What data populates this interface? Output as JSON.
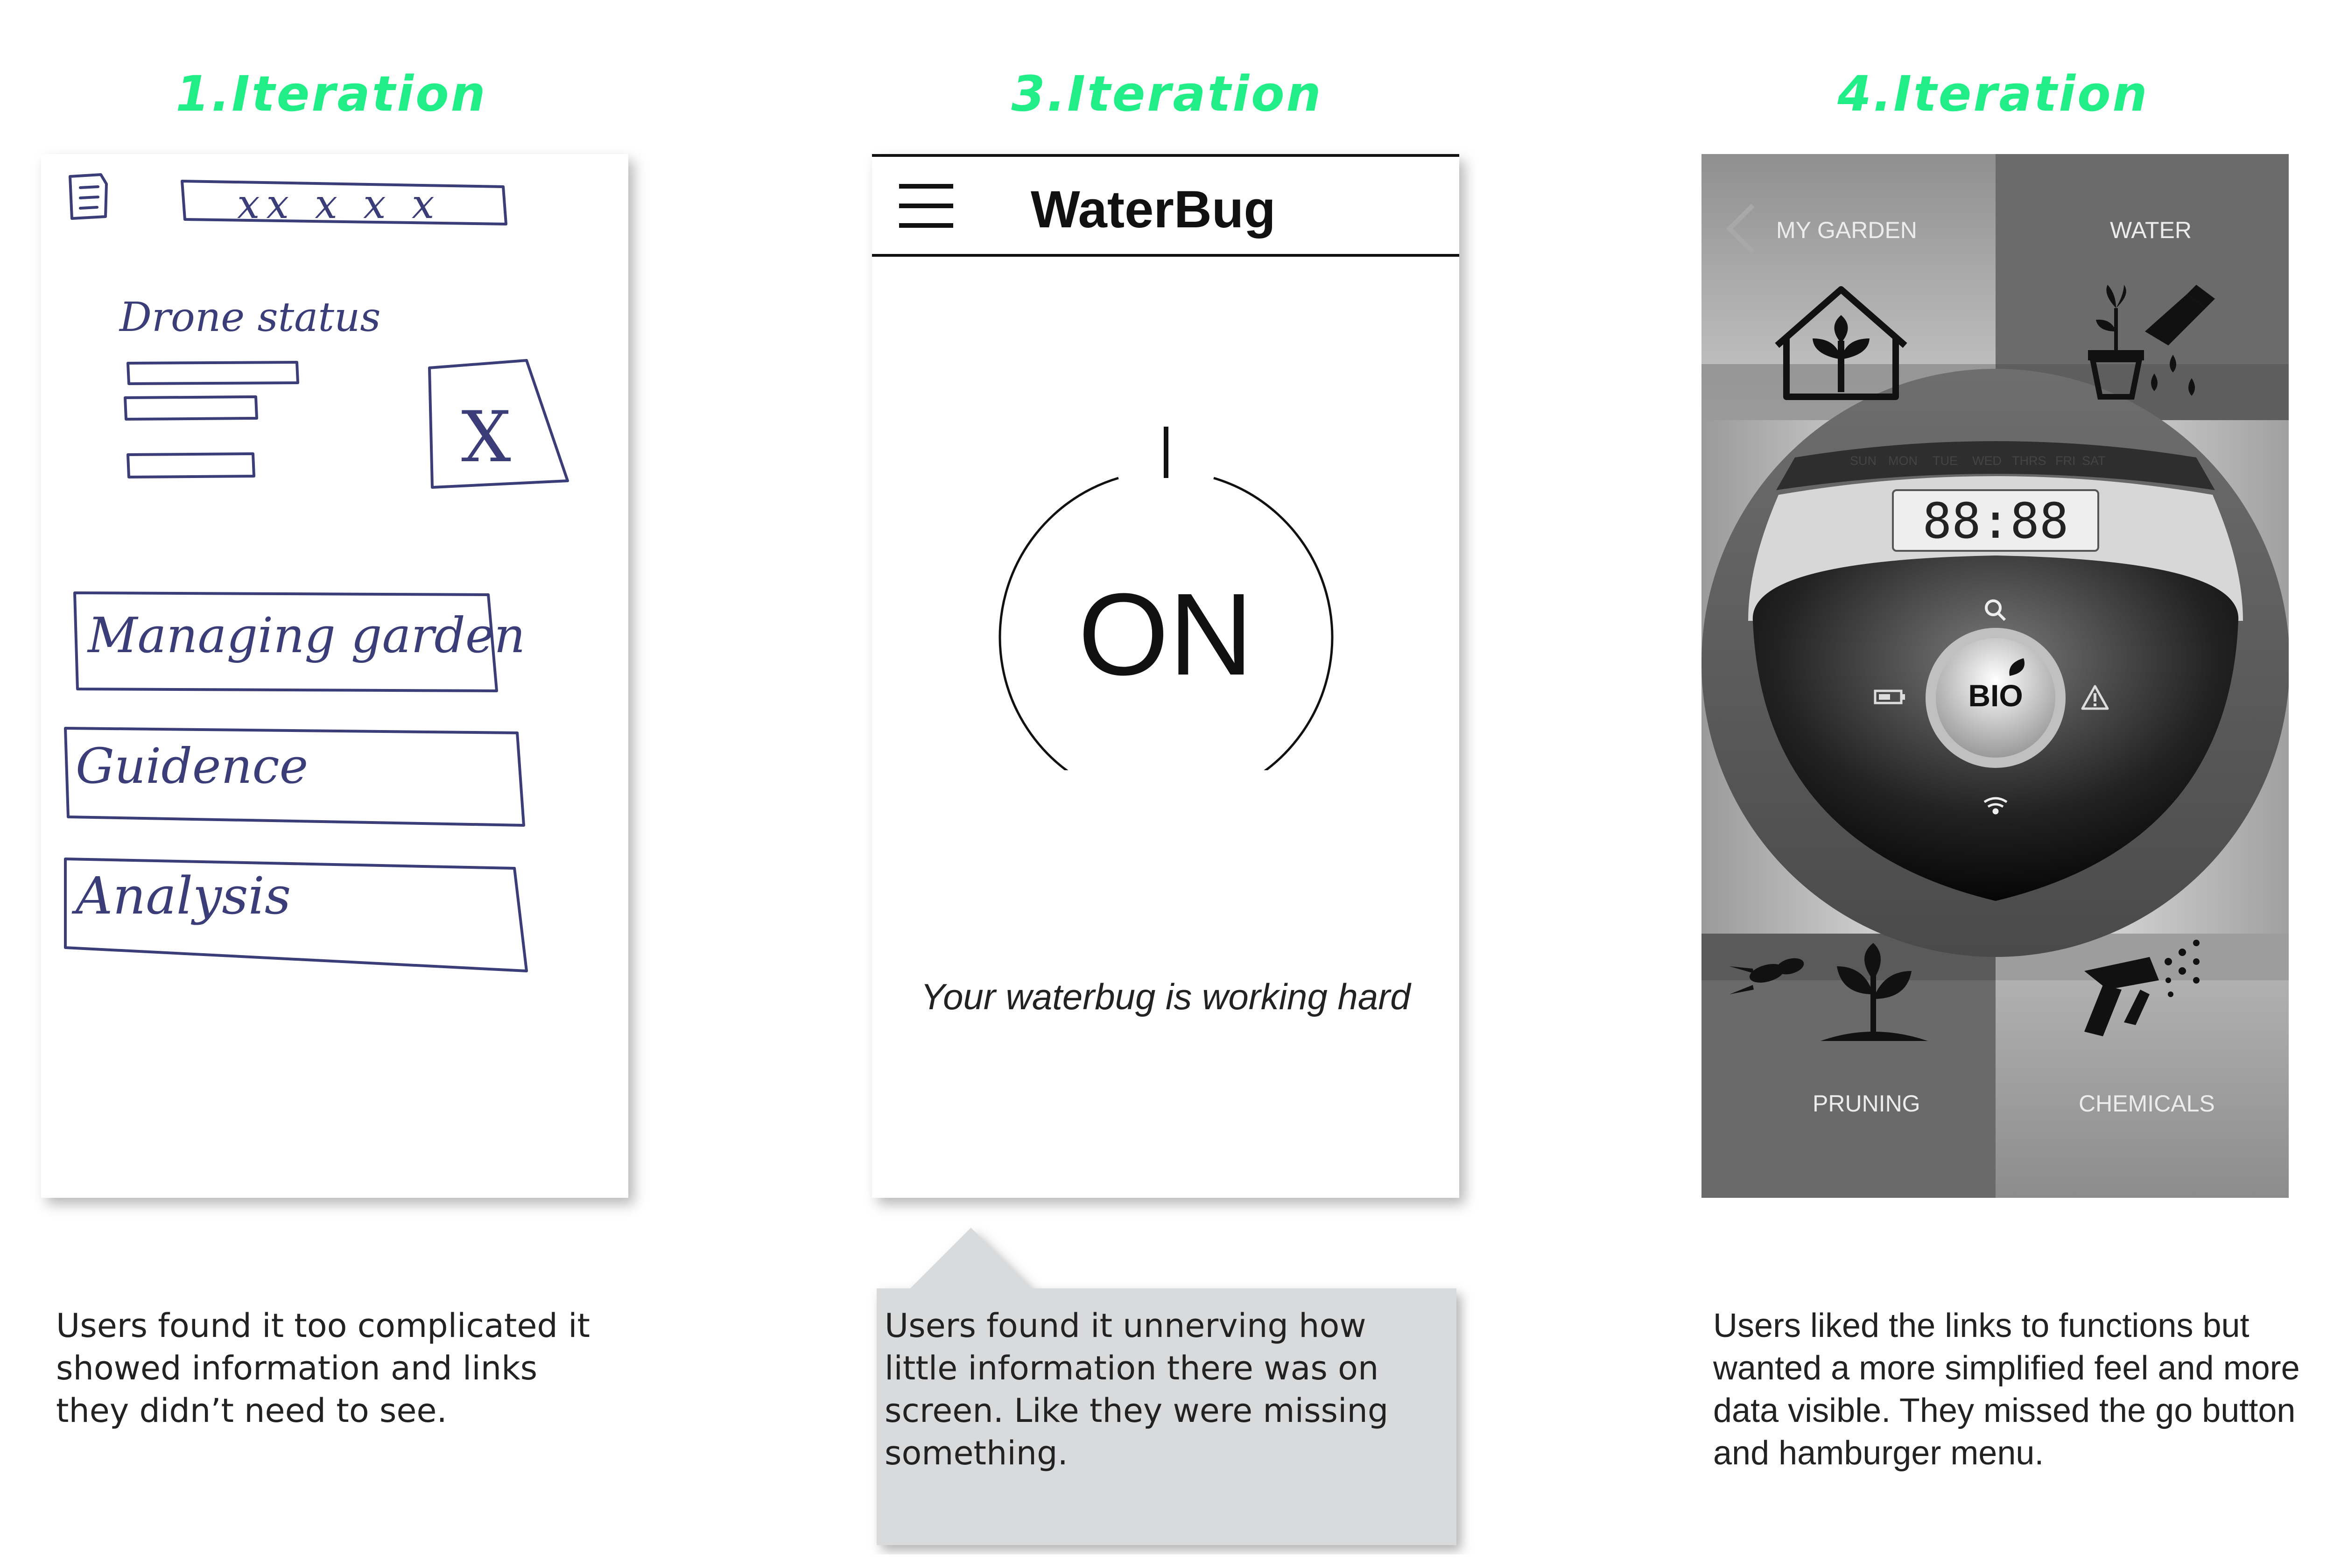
{
  "iterations": {
    "first": {
      "title": "1.Iteration",
      "sketch": {
        "search_text": "xx x x x",
        "drone_status": "Drone status",
        "placeholder_mark": "X",
        "buttons": [
          "Managing garden",
          "Guidence",
          "Analysis"
        ]
      },
      "caption": "Users found it too complicated it showed information and links they didn’t need to see."
    },
    "third": {
      "title": "3.Iteration",
      "app_title": "WaterBug",
      "power_state": "ON",
      "status_text": "Your waterbug is working hard",
      "caption": "Users found it unnerving how little information there was on screen. Like they were missing something."
    },
    "fourth": {
      "title": "4.Iteration",
      "tiles": {
        "top_left": "MY GARDEN",
        "top_right": "WATER",
        "bottom_left": "PRUNING",
        "bottom_right": "CHEMICALS"
      },
      "days": [
        "SUN",
        "MON",
        "TUE",
        "WED",
        "THRS",
        "FRI",
        "SAT"
      ],
      "clock": "88:88",
      "center_button": "BIO",
      "caption": "Users liked the links to functions but wanted a more simplified feel and more data visible. They missed the go button and hamburger menu."
    }
  },
  "colors": {
    "title_accent": "#22ee88",
    "sketch_ink": "#3a3d78",
    "caption_bubble": "#d9dadc"
  },
  "icons": [
    "note-icon",
    "menu-icon",
    "power-icon",
    "back-chevron-icon",
    "house-plant-icon",
    "watering-can-icon",
    "search-icon",
    "battery-icon",
    "warning-icon",
    "wifi-icon",
    "leaf-icon",
    "shears-icon",
    "sprayer-icon"
  ]
}
